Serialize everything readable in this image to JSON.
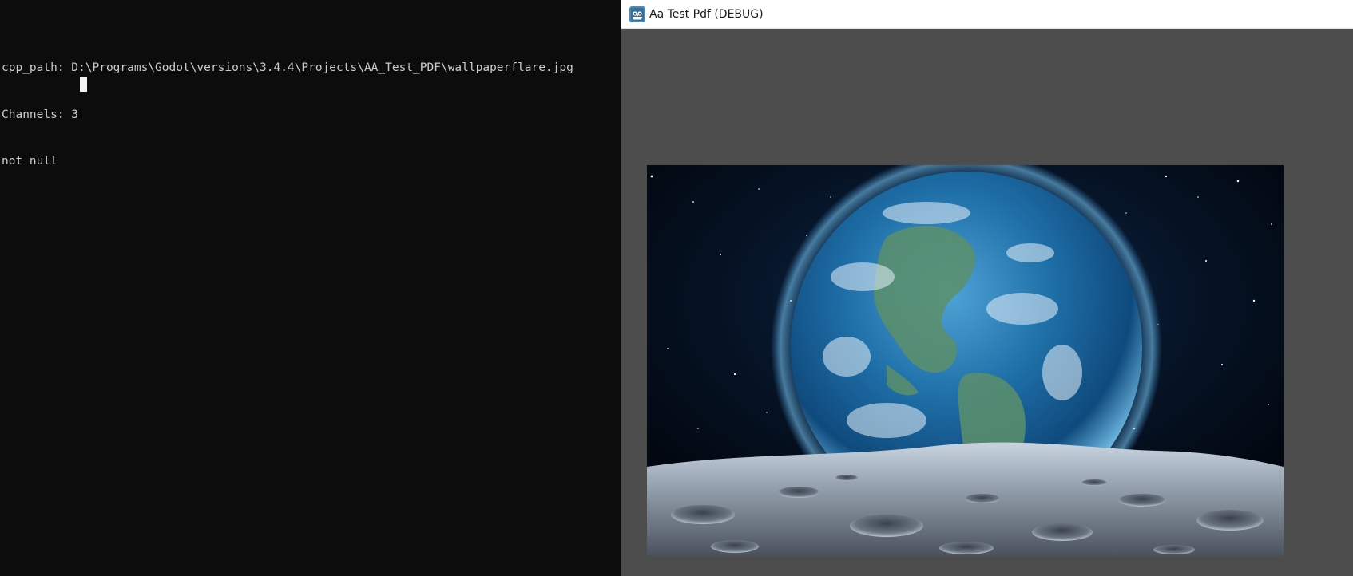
{
  "console": {
    "lines": [
      "cpp_path: D:\\Programs\\Godot\\versions\\3.4.4\\Projects\\AA_Test_PDF\\wallpaperflare.jpg",
      "Channels: 3",
      "not null"
    ]
  },
  "godot_window": {
    "title": "Aa Test Pdf (DEBUG)",
    "icon": "godot-icon",
    "image_subject": "earth-from-moon-wallpaper"
  },
  "colors": {
    "console_bg": "#0c0c0c",
    "console_text": "#cccccc",
    "viewport_bg": "#4d4d4d",
    "titlebar_bg": "#ffffff"
  }
}
